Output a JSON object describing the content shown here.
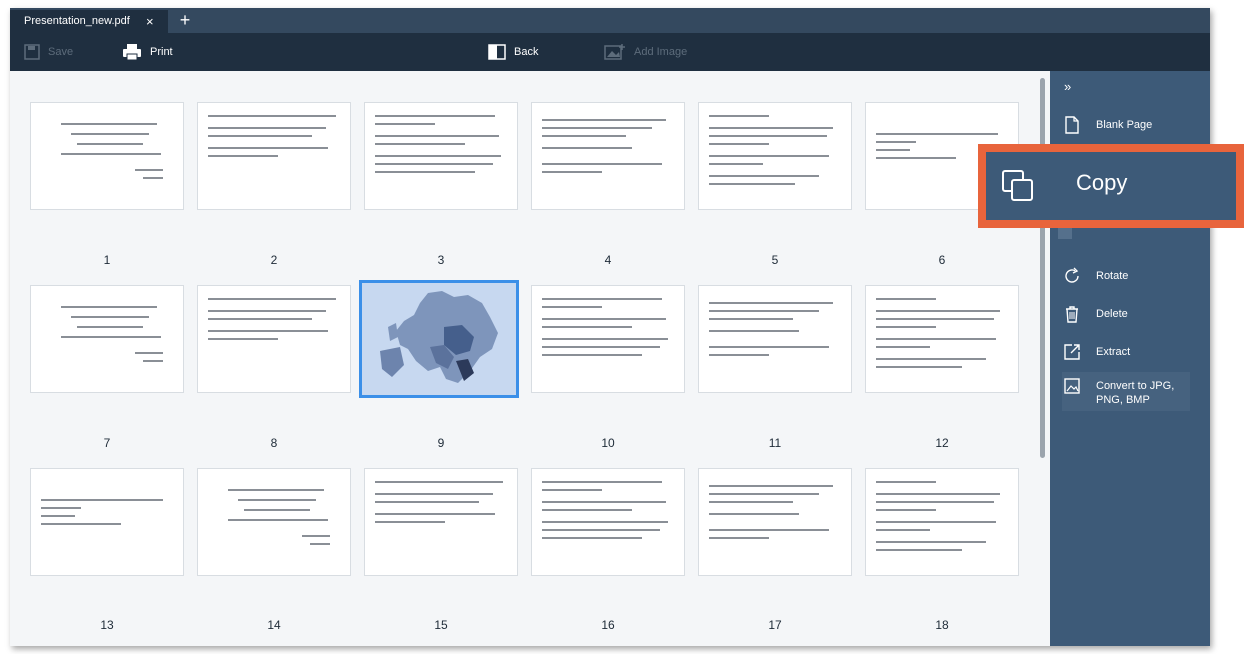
{
  "tabbar": {
    "tab_title": "Presentation_new.pdf",
    "close_glyph": "×",
    "add_glyph": "+"
  },
  "toolbar": {
    "save_label": "Save",
    "print_label": "Print",
    "back_label": "Back",
    "add_image_label": "Add Image"
  },
  "pages": {
    "numbers": [
      "1",
      "2",
      "3",
      "4",
      "5",
      "6",
      "7",
      "8",
      "9",
      "10",
      "11",
      "12",
      "13",
      "14",
      "15",
      "16",
      "17",
      "18"
    ],
    "selected": "9"
  },
  "sidebar": {
    "collapse_glyph": "»",
    "items": [
      {
        "label": "Blank Page",
        "icon": "blank-page-icon"
      },
      {
        "label": "Rotate",
        "icon": "rotate-icon"
      },
      {
        "label": "Delete",
        "icon": "trash-icon"
      },
      {
        "label": "Extract",
        "icon": "extract-icon"
      },
      {
        "label": "Convert to JPG, PNG, BMP",
        "icon": "image-icon"
      }
    ]
  },
  "callout": {
    "label": "Copy",
    "icon": "copy-icon"
  },
  "colors": {
    "dark": "#1f2f40",
    "sidebar": "#3d5a78",
    "highlight": "#e8643c",
    "selection": "#3b8fe8"
  }
}
